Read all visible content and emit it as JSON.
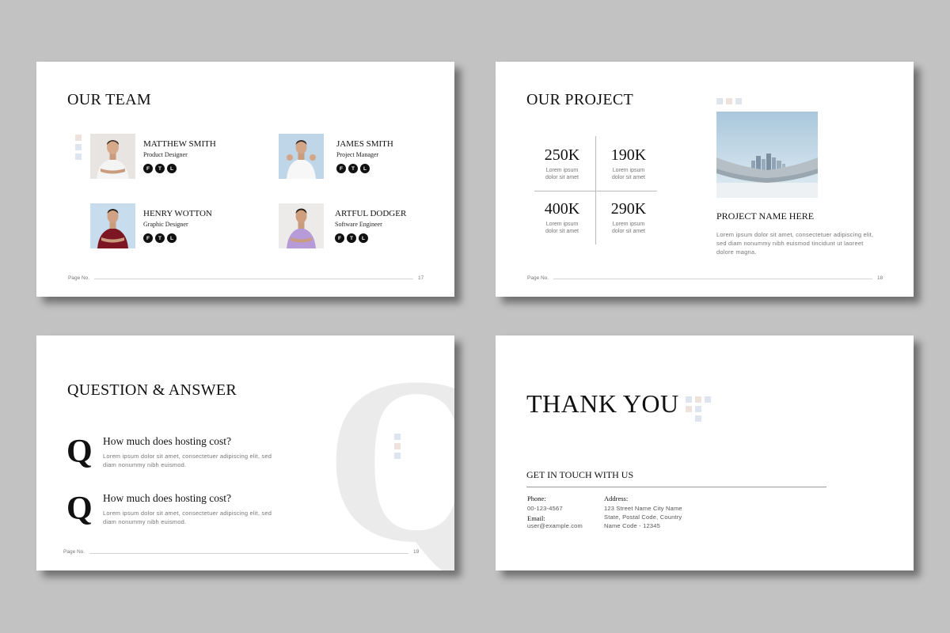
{
  "slide1": {
    "title": "OUR TEAM",
    "members": [
      {
        "name": "MATTHEW SMITH",
        "role": "Product Designer",
        "shirt": "#f4f4f4",
        "bg": "#e7e4e2"
      },
      {
        "name": "JAMES SMITH",
        "role": "Project Manager",
        "shirt": "#f7f7f7",
        "bg": "#bfd6e8"
      },
      {
        "name": "HENRY WOTTON",
        "role": "Graphic Designer",
        "shirt": "#7b1622",
        "bg": "#c7dced"
      },
      {
        "name": "ARTFUL DODGER",
        "role": "Software Engineer",
        "shirt": "#b79bd8",
        "bg": "#ecebea"
      }
    ],
    "social": [
      "F",
      "T",
      "L"
    ],
    "footer_label": "Page No.",
    "page_num": "17"
  },
  "slide2": {
    "title": "OUR PROJECT",
    "stats": [
      {
        "value": "250K",
        "label": "Lorem ipsum\ndolor sit amet"
      },
      {
        "value": "190K",
        "label": "Lorem ipsum\ndolor sit amet"
      },
      {
        "value": "400K",
        "label": "Lorem ipsum\ndolor sit amet"
      },
      {
        "value": "290K",
        "label": "Lorem ipsum\ndolor sit amet"
      }
    ],
    "project_name": "PROJECT NAME HERE",
    "project_desc": "Lorem ipsum dolor sit amet, consectetuer adipiscing elit, sed diam nonummy nibh euismod tincidunt ut laoreet dolore magna.",
    "footer_label": "Page No.",
    "page_num": "18"
  },
  "slide3": {
    "title": "QUESTION & ANSWER",
    "big_letter": "Q",
    "items": [
      {
        "letter": "Q",
        "question": "How much does hosting cost?",
        "answer": "Lorem ipsum dolor sit amet, consectetuer adipiscing elit, sed diam nonummy nibh euismod."
      },
      {
        "letter": "Q",
        "question": "How much does hosting cost?",
        "answer": "Lorem ipsum dolor sit amet, consectetuer adipiscing elit, sed diam nonummy nibh euismod."
      }
    ],
    "footer_label": "Page No.",
    "page_num": "19"
  },
  "slide4": {
    "title": "THANK YOU",
    "subtitle": "GET IN TOUCH WITH US",
    "phone_label": "Phone:",
    "phone": "00-123-4567",
    "email_label": "Email:",
    "email": "user@example.com",
    "address_label": "Address:",
    "address_lines": [
      "123 Street Name City Name",
      "State, Postal Code, Country",
      "Name Code - 12345"
    ]
  },
  "colors": {
    "background": "#c2c2c2",
    "accent_pink": "#eee3dc",
    "accent_blue": "#dfe5ee",
    "ghost_letter": "#ebebeb"
  }
}
